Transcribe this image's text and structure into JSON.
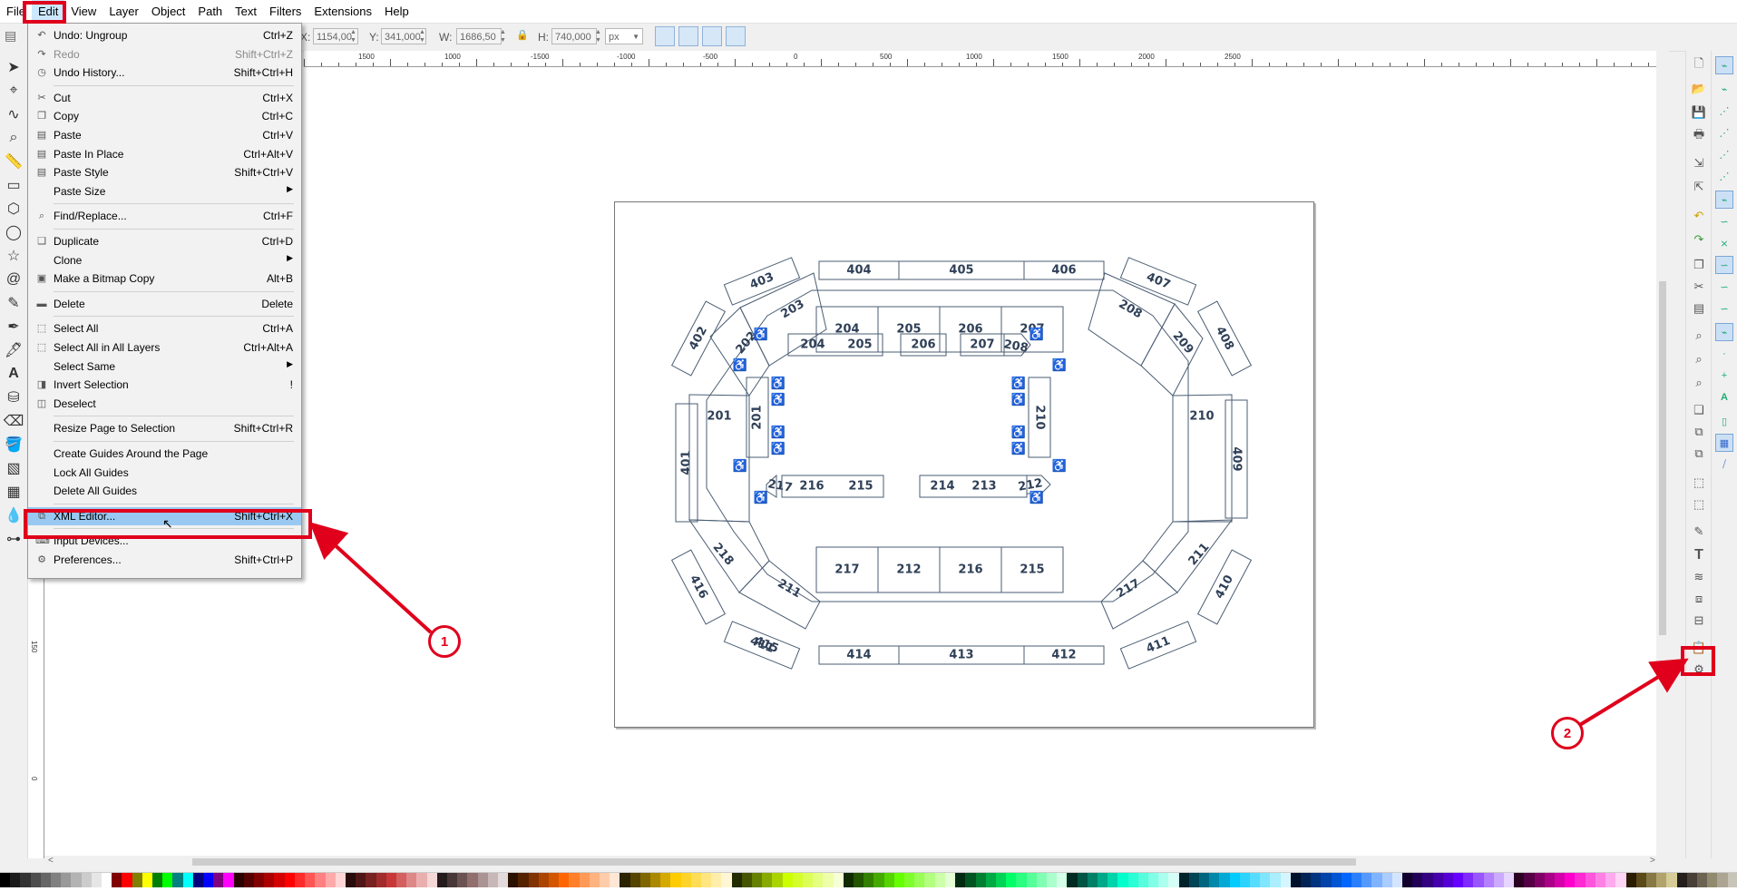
{
  "menubar": [
    "File",
    "Edit",
    "View",
    "Layer",
    "Object",
    "Path",
    "Text",
    "Filters",
    "Extensions",
    "Help"
  ],
  "controls": {
    "x_label": "X:",
    "x_value": "1154,00",
    "y_label": "Y:",
    "y_value": "341,000",
    "w_label": "W:",
    "w_value": "1686,50",
    "h_label": "H:",
    "h_value": "740,000",
    "unit": "px"
  },
  "ruler_labels": [
    "1500",
    "1000",
    "-1500",
    "-1000",
    "-500",
    "0",
    "500",
    "1000",
    "1500",
    "2000",
    "2500"
  ],
  "vruler_labels": [
    "150",
    "0"
  ],
  "edit_menu": [
    {
      "label": "Undo: Ungroup",
      "shortcut": "Ctrl+Z",
      "icon": "undo-icon",
      "glyph": "↶"
    },
    {
      "label": "Redo",
      "shortcut": "Shift+Ctrl+Z",
      "icon": "redo-icon",
      "glyph": "↷",
      "disabled": true
    },
    {
      "label": "Undo History...",
      "shortcut": "Shift+Ctrl+H",
      "icon": "history-icon",
      "glyph": "◷"
    },
    {
      "sep": true
    },
    {
      "label": "Cut",
      "shortcut": "Ctrl+X",
      "icon": "scissors-icon",
      "glyph": "✂"
    },
    {
      "label": "Copy",
      "shortcut": "Ctrl+C",
      "icon": "copy-icon",
      "glyph": "❐"
    },
    {
      "label": "Paste",
      "shortcut": "Ctrl+V",
      "icon": "paste-icon",
      "glyph": "▤"
    },
    {
      "label": "Paste In Place",
      "shortcut": "Ctrl+Alt+V",
      "icon": "paste-in-place-icon",
      "glyph": "▤"
    },
    {
      "label": "Paste Style",
      "shortcut": "Shift+Ctrl+V",
      "icon": "paste-style-icon",
      "glyph": "▤"
    },
    {
      "label": "Paste Size",
      "shortcut": "",
      "icon": "",
      "glyph": "",
      "submenu": true
    },
    {
      "sep": true
    },
    {
      "label": "Find/Replace...",
      "shortcut": "Ctrl+F",
      "icon": "find-icon",
      "glyph": "⌕"
    },
    {
      "sep": true
    },
    {
      "label": "Duplicate",
      "shortcut": "Ctrl+D",
      "icon": "duplicate-icon",
      "glyph": "❑"
    },
    {
      "label": "Clone",
      "shortcut": "",
      "icon": "",
      "glyph": "",
      "submenu": true
    },
    {
      "label": "Make a Bitmap Copy",
      "shortcut": "Alt+B",
      "icon": "bitmap-copy-icon",
      "glyph": "▣"
    },
    {
      "sep": true
    },
    {
      "label": "Delete",
      "shortcut": "Delete",
      "icon": "delete-icon",
      "glyph": "▬"
    },
    {
      "sep": true
    },
    {
      "label": "Select All",
      "shortcut": "Ctrl+A",
      "icon": "select-all-icon",
      "glyph": "⬚"
    },
    {
      "label": "Select All in All Layers",
      "shortcut": "Ctrl+Alt+A",
      "icon": "select-all-layers-icon",
      "glyph": "⬚"
    },
    {
      "label": "Select Same",
      "shortcut": "",
      "icon": "",
      "glyph": "",
      "submenu": true
    },
    {
      "label": "Invert Selection",
      "shortcut": "!",
      "icon": "invert-selection-icon",
      "glyph": "◨"
    },
    {
      "label": "Deselect",
      "shortcut": "",
      "icon": "deselect-icon",
      "glyph": "◫"
    },
    {
      "sep": true
    },
    {
      "label": "Resize Page to Selection",
      "shortcut": "Shift+Ctrl+R",
      "icon": "",
      "glyph": ""
    },
    {
      "sep": true
    },
    {
      "label": "Create Guides Around the Page",
      "shortcut": "",
      "icon": "",
      "glyph": ""
    },
    {
      "label": "Lock All Guides",
      "shortcut": "",
      "icon": "",
      "glyph": ""
    },
    {
      "label": "Delete All Guides",
      "shortcut": "",
      "icon": "",
      "glyph": ""
    },
    {
      "sep": true
    },
    {
      "label": "XML Editor...",
      "shortcut": "Shift+Ctrl+X",
      "icon": "xml-editor-icon",
      "glyph": "⧉",
      "highlight": true
    },
    {
      "sep": true
    },
    {
      "label": "Input Devices...",
      "shortcut": "",
      "icon": "input-devices-icon",
      "glyph": "⌨"
    },
    {
      "label": "Preferences...",
      "shortcut": "Shift+Ctrl+P",
      "icon": "preferences-icon",
      "glyph": "⚙"
    }
  ],
  "sections": {
    "upper": [
      "404",
      "405",
      "406",
      "407",
      "403",
      "402",
      "408"
    ],
    "lower": [
      "414",
      "413",
      "412",
      "411",
      "415",
      "416",
      "410"
    ],
    "side": [
      "401",
      "409"
    ],
    "ring200": [
      "204",
      "205",
      "206",
      "207",
      "203",
      "208",
      "202",
      "209",
      "201",
      "210",
      "218",
      "211",
      "217",
      "212",
      "216",
      "215",
      "214",
      "213"
    ],
    "inner": [
      "204",
      "205",
      "206",
      "207",
      "208",
      "201",
      "210",
      "217",
      "216",
      "215",
      "214",
      "213",
      "212"
    ]
  },
  "callouts": [
    "1",
    "2"
  ],
  "palette": [
    "#000000",
    "#1a1a1a",
    "#333333",
    "#4d4d4d",
    "#666666",
    "#808080",
    "#999999",
    "#b3b3b3",
    "#cccccc",
    "#e6e6e6",
    "#ffffff",
    "#800000",
    "#ff0000",
    "#808000",
    "#ffff00",
    "#008000",
    "#00ff00",
    "#008080",
    "#00ffff",
    "#000080",
    "#0000ff",
    "#800080",
    "#ff00ff",
    "#2b0000",
    "#550000",
    "#800000",
    "#aa0000",
    "#d40000",
    "#ff0000",
    "#ff2a2a",
    "#ff5555",
    "#ff8080",
    "#ffaaaa",
    "#ffd5d5",
    "#280b0b",
    "#501616",
    "#782121",
    "#a02c2c",
    "#c83737",
    "#d35f5f",
    "#de8787",
    "#e9afaf",
    "#f4d7d7",
    "#241c1c",
    "#483737",
    "#6c5353",
    "#916f6f",
    "#ac9393",
    "#c8b7b7",
    "#e3dbdb",
    "#2b1100",
    "#552200",
    "#803300",
    "#aa4400",
    "#d45500",
    "#ff6600",
    "#ff7f2a",
    "#ff9955",
    "#ffb380",
    "#ffccaa",
    "#ffe6d5",
    "#2b2200",
    "#554400",
    "#806600",
    "#aa8800",
    "#d4aa00",
    "#ffcc00",
    "#ffd42a",
    "#ffdd55",
    "#ffe680",
    "#ffeeaa",
    "#fff6d5",
    "#222b00",
    "#445500",
    "#668000",
    "#88aa00",
    "#aad400",
    "#ccff00",
    "#d4ff2a",
    "#ddff55",
    "#e5ff80",
    "#eeffaa",
    "#f6ffd5",
    "#112b00",
    "#225500",
    "#338000",
    "#44aa00",
    "#55d400",
    "#66ff00",
    "#7fff2a",
    "#99ff55",
    "#b3ff80",
    "#ccffaa",
    "#e5ffd5",
    "#002b11",
    "#005522",
    "#008033",
    "#00aa44",
    "#00d455",
    "#00ff66",
    "#2aff80",
    "#55ff99",
    "#80ffb3",
    "#aaffcc",
    "#d5ffe6",
    "#002b22",
    "#005544",
    "#008066",
    "#00aa88",
    "#00d4aa",
    "#00ffcc",
    "#2affd5",
    "#55ffdd",
    "#80ffe6",
    "#aaffee",
    "#d5fff6",
    "#00222b",
    "#004455",
    "#006680",
    "#0088aa",
    "#00aad4",
    "#00ccff",
    "#2ad4ff",
    "#55ddff",
    "#80e5ff",
    "#aaeeff",
    "#d5f6ff",
    "#00112b",
    "#002255",
    "#003380",
    "#0044aa",
    "#0055d4",
    "#0066ff",
    "#2a7fff",
    "#5599ff",
    "#80b3ff",
    "#aaccff",
    "#d5e5ff",
    "#11002b",
    "#220055",
    "#330080",
    "#4400aa",
    "#5500d4",
    "#6600ff",
    "#7f2aff",
    "#9955ff",
    "#b380ff",
    "#ccaaff",
    "#e5d5ff",
    "#2b0022",
    "#550044",
    "#800066",
    "#aa0088",
    "#d400aa",
    "#ff00cc",
    "#ff2ad4",
    "#ff55dd",
    "#ff80e5",
    "#ffaaee",
    "#ffd5f6",
    "#2b1d00",
    "#5b4a1a",
    "#877845",
    "#b0a36c",
    "#d6cc98",
    "#241f1c",
    "#484037",
    "#6c6353",
    "#918a6f",
    "#aca593",
    "#c8c4b7"
  ]
}
